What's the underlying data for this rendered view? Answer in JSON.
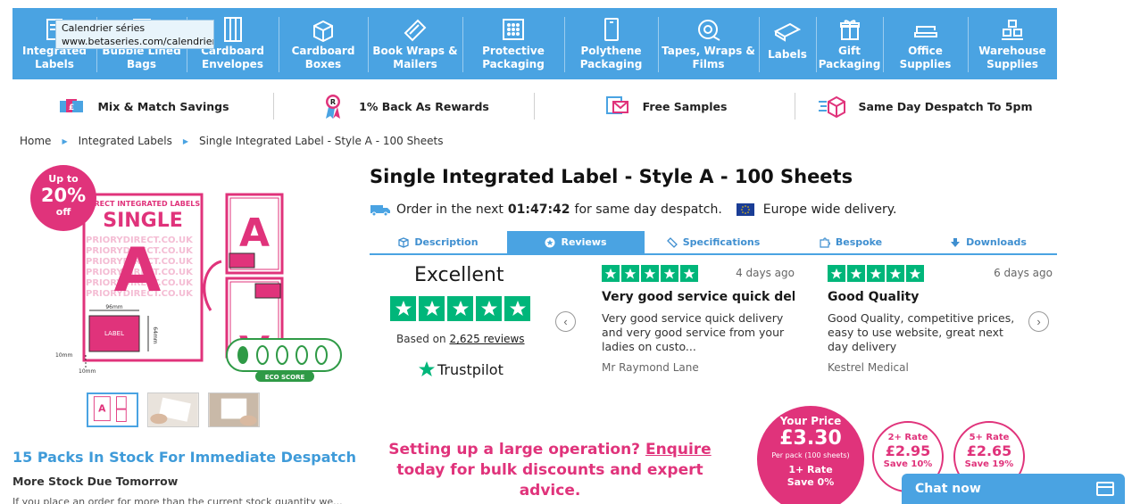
{
  "tooltip": {
    "line1": "Calendrier séries",
    "line2": "www.betaseries.com/calendrier"
  },
  "nav": [
    {
      "label_1": "Integrated",
      "label_2": "Labels",
      "icon": "labels-icon"
    },
    {
      "label_1": "Bubble Lined",
      "label_2": "Bags",
      "icon": "bubble-bag-icon"
    },
    {
      "label_1": "Cardboard",
      "label_2": "Envelopes",
      "icon": "envelope-icon"
    },
    {
      "label_1": "Cardboard",
      "label_2": "Boxes",
      "icon": "box-icon"
    },
    {
      "label_1": "Book Wraps &",
      "label_2": "Mailers",
      "icon": "book-wrap-icon"
    },
    {
      "label_1": "Protective",
      "label_2": "Packaging",
      "icon": "bubble-wrap-icon"
    },
    {
      "label_1": "Polythene",
      "label_2": "Packaging",
      "icon": "polythene-bag-icon"
    },
    {
      "label_1": "Tapes, Wraps &",
      "label_2": "Films",
      "icon": "tape-icon"
    },
    {
      "label_1": "Labels",
      "label_2": "",
      "icon": "label-roll-icon"
    },
    {
      "label_1": "Gift",
      "label_2": "Packaging",
      "icon": "gift-icon"
    },
    {
      "label_1": "Office",
      "label_2": "Supplies",
      "icon": "stapler-icon"
    },
    {
      "label_1": "Warehouse",
      "label_2": "Supplies",
      "icon": "warehouse-icon"
    }
  ],
  "usp": [
    {
      "label": "Mix & Match Savings",
      "icon": "mix-match-icon"
    },
    {
      "label": "1% Back As Rewards",
      "icon": "rewards-ribbon-icon"
    },
    {
      "label": "Free Samples",
      "icon": "samples-icon"
    },
    {
      "label": "Same Day Despatch To 5pm",
      "icon": "despatch-box-icon"
    }
  ],
  "breadcrumb": [
    "Home",
    "Integrated Labels",
    "Single Integrated Label - Style A - 100 Sheets"
  ],
  "promo": {
    "line1": "Up to",
    "line2": "20%",
    "line3": "off"
  },
  "image": {
    "header": "DIRECT INTEGRATED LABELS",
    "single": "SINGLE",
    "letter": "A",
    "watermark": "PRIORYDIRECT.CO.UK",
    "dim_w": "96mm",
    "dim_h": "64mm",
    "label": "LABEL",
    "margin": "10mm",
    "eco": "ECO SCORE"
  },
  "product": {
    "title": "Single Integrated Label - Style A - 100 Sheets",
    "order_prefix": "Order in the next",
    "countdown": "01:47:42",
    "order_suffix": "for same day despatch.",
    "europe": "Europe wide delivery."
  },
  "tabs": [
    {
      "label": "Description",
      "icon": "cube-icon",
      "active": false
    },
    {
      "label": "Reviews",
      "icon": "star-badge-icon",
      "active": true
    },
    {
      "label": "Specifications",
      "icon": "ruler-icon",
      "active": false
    },
    {
      "label": "Bespoke",
      "icon": "puzzle-icon",
      "active": false
    },
    {
      "label": "Downloads",
      "icon": "download-icon",
      "active": false
    }
  ],
  "trustpilot": {
    "rating_text": "Excellent",
    "stars": 5,
    "based_prefix": "Based on",
    "review_count": "2,625 reviews",
    "logo_text": "Trustpilot",
    "star_color": "#00b67a"
  },
  "reviews": [
    {
      "stars": 5,
      "date": "4 days ago",
      "title": "Very good service quick delive...",
      "body": "Very good service quick delivery and very good service from your ladies on custo...",
      "author": "Mr Raymond Lane"
    },
    {
      "stars": 5,
      "date": "6 days ago",
      "title": "Good Quality",
      "body": "Good Quality, competitive prices, easy to use website, great next day delivery",
      "author": "Kestrel Medical"
    }
  ],
  "stock": {
    "title": "15 Packs In Stock For Immediate Despatch",
    "subtitle": "More Stock Due Tomorrow",
    "note": "If you place an order for more than the current stock quantity we..."
  },
  "bulk": {
    "prefix": "Setting up a large operation?",
    "link": "Enquire",
    "suffix": "today for bulk discounts and expert advice."
  },
  "price": {
    "main": {
      "label": "Your Price",
      "amount": "£3.30",
      "per": "Per pack (100 sheets)",
      "rate": "1+ Rate",
      "save": "Save 0%"
    },
    "tiers": [
      {
        "rate": "2+ Rate",
        "amount": "£2.95",
        "save": "Save 10%"
      },
      {
        "rate": "5+ Rate",
        "amount": "£2.65",
        "save": "Save 19%"
      }
    ]
  },
  "chat": {
    "label": "Chat now"
  },
  "colors": {
    "brand_blue": "#4aa3e2",
    "brand_pink": "#e0337b",
    "trustpilot_green": "#00b67a"
  }
}
